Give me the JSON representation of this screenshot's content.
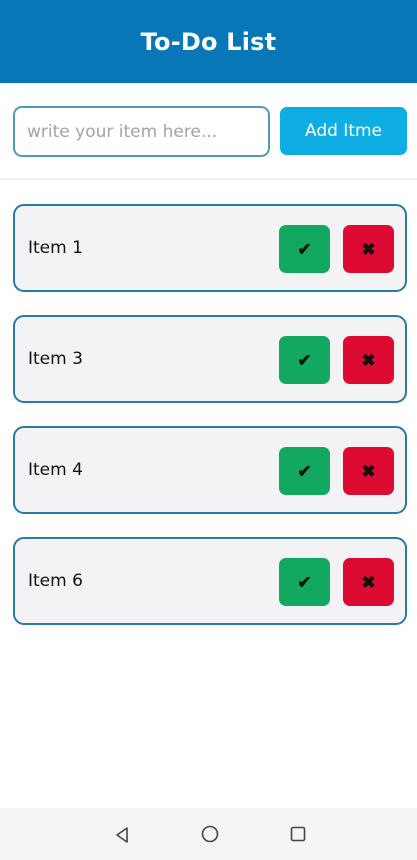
{
  "header": {
    "title": "To-Do List",
    "color": "#0777b7"
  },
  "input_bar": {
    "input": {
      "value": "",
      "placeholder": "write your item here..."
    },
    "add_button_label": "Add Itme"
  },
  "items": [
    {
      "label": "Item 1",
      "done_icon": "checkmark-icon",
      "delete_icon": "cross-icon"
    },
    {
      "label": "Item 3",
      "done_icon": "checkmark-icon",
      "delete_icon": "cross-icon"
    },
    {
      "label": "Item 4",
      "done_icon": "checkmark-icon",
      "delete_icon": "cross-icon"
    },
    {
      "label": "Item 6",
      "done_icon": "checkmark-icon",
      "delete_icon": "cross-icon"
    }
  ],
  "glyphs": {
    "check": "✔",
    "cross": "✖"
  },
  "colors": {
    "done": "#12a860",
    "delete": "#dd0a32",
    "add_button": "#0eaee4",
    "item_border": "#2b79a5"
  },
  "nav_bar": {
    "icons": [
      "back-triangle-icon",
      "home-circle-icon",
      "recent-square-icon"
    ]
  }
}
